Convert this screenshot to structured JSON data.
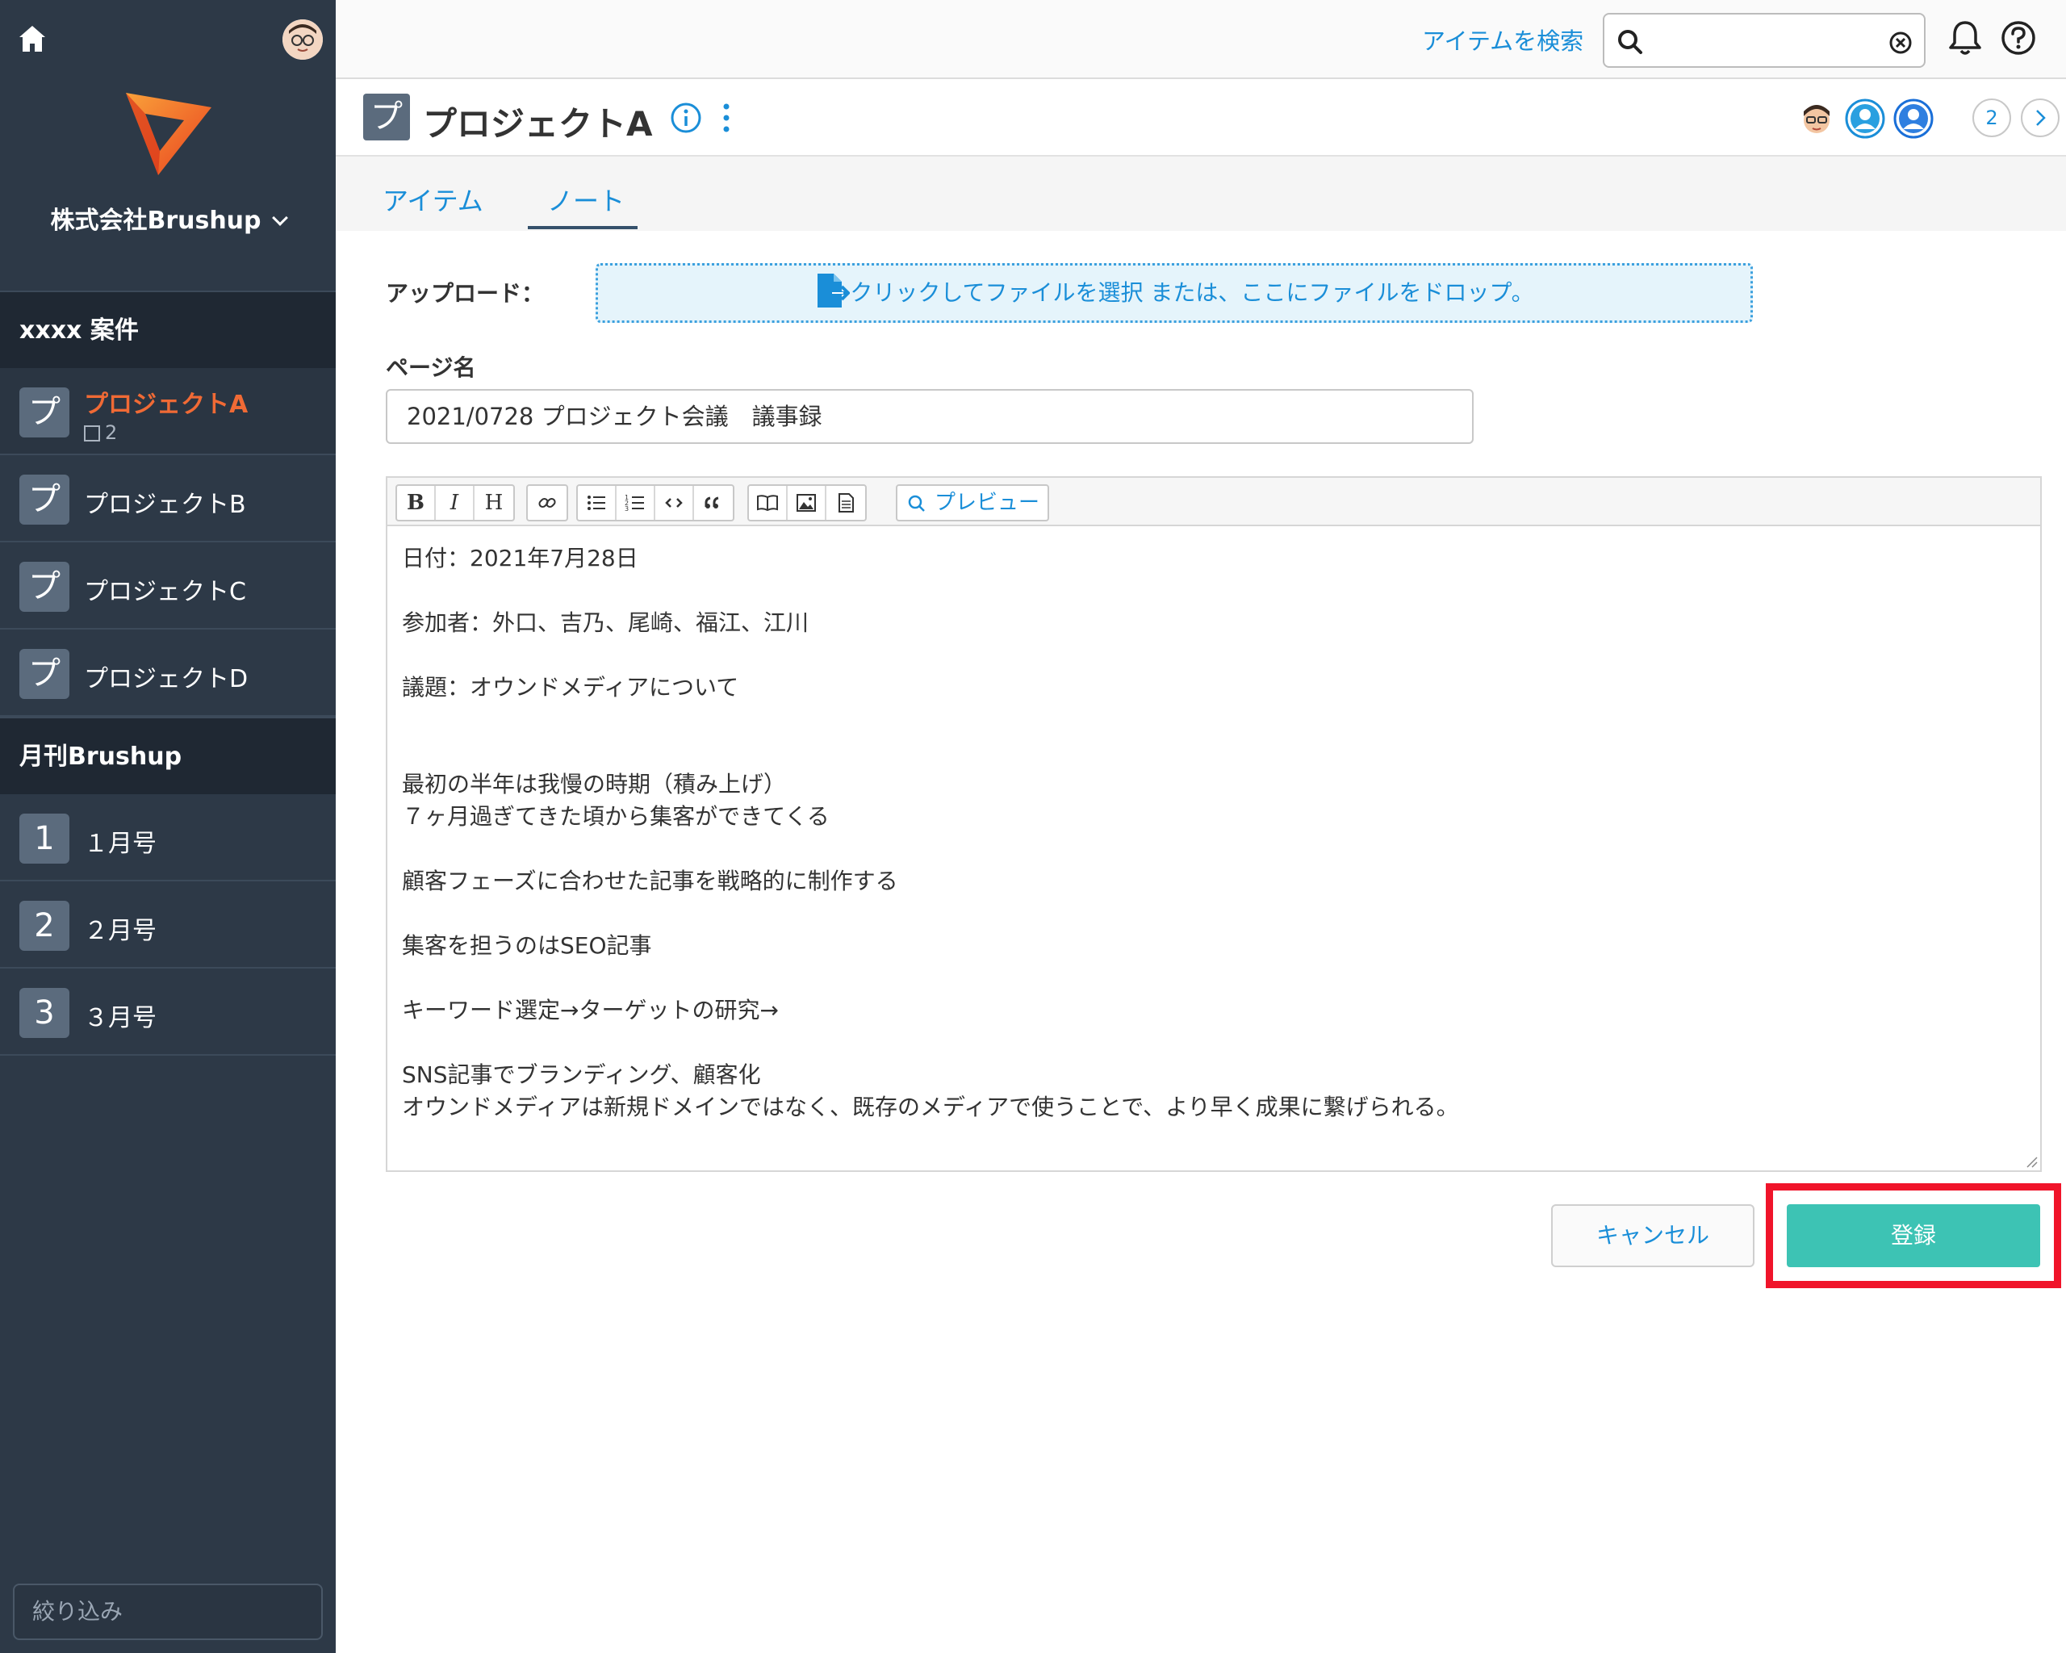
{
  "sidebar": {
    "company": "株式会社Brushup",
    "groups": [
      {
        "title": "xxxx 案件",
        "items": [
          {
            "badge": "プ",
            "label": "プロジェクトA",
            "sub": "2"
          },
          {
            "badge": "プ",
            "label": "プロジェクトB"
          },
          {
            "badge": "プ",
            "label": "プロジェクトC"
          },
          {
            "badge": "プ",
            "label": "プロジェクトD"
          }
        ]
      },
      {
        "title": "月刊Brushup",
        "items": [
          {
            "badge": "1",
            "label": "１月号"
          },
          {
            "badge": "2",
            "label": "２月号"
          },
          {
            "badge": "3",
            "label": "３月号"
          }
        ]
      }
    ],
    "filter_placeholder": "絞り込み"
  },
  "topbar": {
    "search_link": "アイテムを検索",
    "search_value": ""
  },
  "project": {
    "badge": "プ",
    "title": "プロジェクトA",
    "member_overflow": "2"
  },
  "tabs": [
    {
      "label": "アイテム",
      "active": false
    },
    {
      "label": "ノート",
      "active": true
    }
  ],
  "form": {
    "upload_label": "アップロード：",
    "dropzone_text": "クリックしてファイルを選択 または、ここにファイルをドロップ。",
    "page_name_label": "ページ名",
    "page_name_value": "2021/0728 プロジェクト会議　議事録",
    "toolbar": {
      "bold": "B",
      "italic": "I",
      "heading": "H",
      "preview": "プレビュー"
    },
    "body_lines": [
      "日付：2021年7月28日",
      "",
      "参加者：外口、吉乃、尾崎、福江、江川",
      "",
      "議題：オウンドメディアについて",
      "",
      "",
      "最初の半年は我慢の時期（積み上げ）",
      "７ヶ月過ぎてきた頃から集客ができてくる",
      "",
      "顧客フェーズに合わせた記事を戦略的に制作する",
      "",
      "集客を担うのはSEO記事",
      "",
      "キーワード選定→ターゲットの研究→",
      "",
      "SNS記事でブランディング、顧客化",
      "オウンドメディアは新規ドメインではなく、既存のメディアで使うことで、より早く成果に繋げられる。"
    ],
    "cancel_label": "キャンセル",
    "submit_label": "登録"
  },
  "colors": {
    "sidebar_bg": "#2d3947",
    "accent_blue": "#1a8ed8",
    "active_orange": "#f06a35",
    "submit_teal": "#3dc3b4",
    "highlight_red": "#f0142a"
  }
}
